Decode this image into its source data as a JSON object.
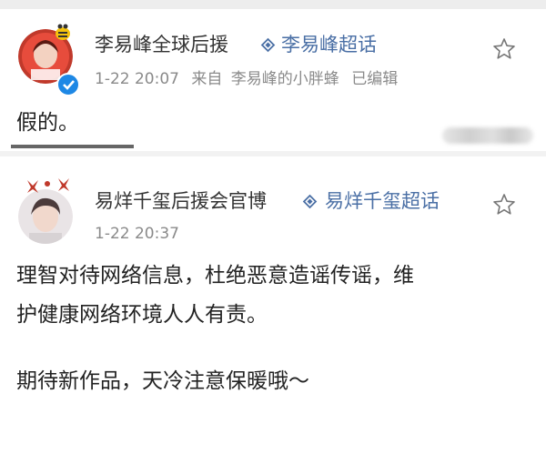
{
  "colors": {
    "supertopic": "#4a6fa5",
    "verified_badge": "#1e88e5",
    "meta": "#8a8a8a"
  },
  "posts": [
    {
      "username": "李易峰全球后援",
      "supertopic_icon": "diamond-icon",
      "supertopic": "李易峰超话",
      "date": "1-22 20:07",
      "source_prefix": "来自",
      "source": "李易峰的小胖蜂",
      "edited": "已编辑",
      "avatar_icon": "avatar-li-yifeng-support",
      "verified_icon": "verified-badge-icon",
      "star_icon": "star-outline-icon",
      "text_lines": [
        "假的。"
      ]
    },
    {
      "username": "易烊千玺后援会官博",
      "supertopic_icon": "diamond-icon",
      "supertopic": "易烊千玺超话",
      "date": "1-22 20:37",
      "avatar_icon": "avatar-yi-yangqianxi-support",
      "star_icon": "star-outline-icon",
      "text_lines": [
        "理智对待网络信息，杜绝恶意造谣传谣，维",
        "护健康网络环境人人有责。",
        "",
        "期待新作品，天冷注意保暖哦～"
      ]
    }
  ]
}
